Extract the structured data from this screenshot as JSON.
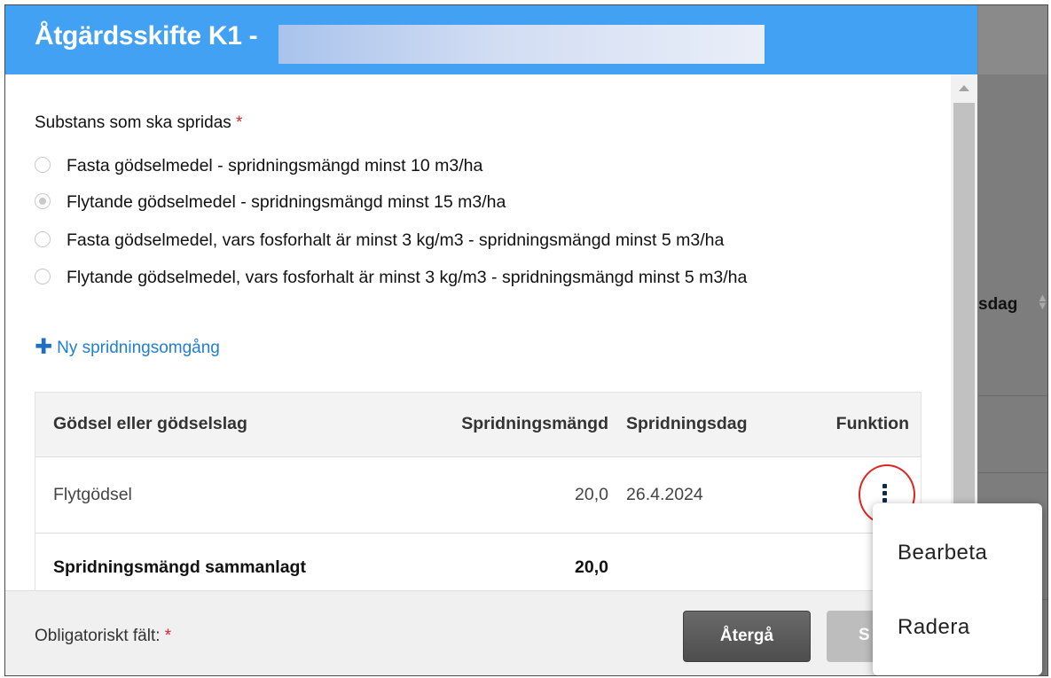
{
  "dialog": {
    "title": "Åtgärdsskifte K1 -"
  },
  "form": {
    "substance_label": "Substans som ska spridas",
    "required_marker": "*",
    "options": [
      {
        "label": "Fasta gödselmedel - spridningsmängd minst 10 m3/ha",
        "selected": false
      },
      {
        "label": "Flytande gödselmedel - spridningsmängd minst 15 m3/ha",
        "selected": true
      },
      {
        "label": "Fasta gödselmedel, vars fosforhalt är minst 3 kg/m3 - spridningsmängd minst 5 m3/ha",
        "selected": false
      },
      {
        "label": "Flytande gödselmedel, vars fosforhalt är minst 3 kg/m3 - spridningsmängd minst 5 m3/ha",
        "selected": false
      }
    ],
    "add_round_label": "Ny spridningsomgång",
    "add_icon": "plus-icon"
  },
  "table": {
    "headers": [
      "Gödsel eller gödselslag",
      "Spridningsmängd",
      "Spridningsdag",
      "Funktion"
    ],
    "rows": [
      {
        "type": "Flytgödsel",
        "amount": "20,0",
        "date": "26.4.2024",
        "function_icon": "kebab-menu-icon"
      }
    ],
    "total_label": "Spridningsmängd sammanlagt",
    "total_value": "20,0"
  },
  "footer": {
    "required_note": "Obligatoriskt fält:",
    "required_marker": "*",
    "back_button": "Återgå",
    "save_button_visible": "S"
  },
  "context_menu": {
    "items": [
      "Bearbeta",
      "Radera"
    ]
  },
  "background": {
    "column_header_partial": "sdag"
  },
  "colors": {
    "header": "#43a1f3",
    "link": "#1f7ed3",
    "required": "#d9232a",
    "annotation_ring": "#e0241f"
  }
}
